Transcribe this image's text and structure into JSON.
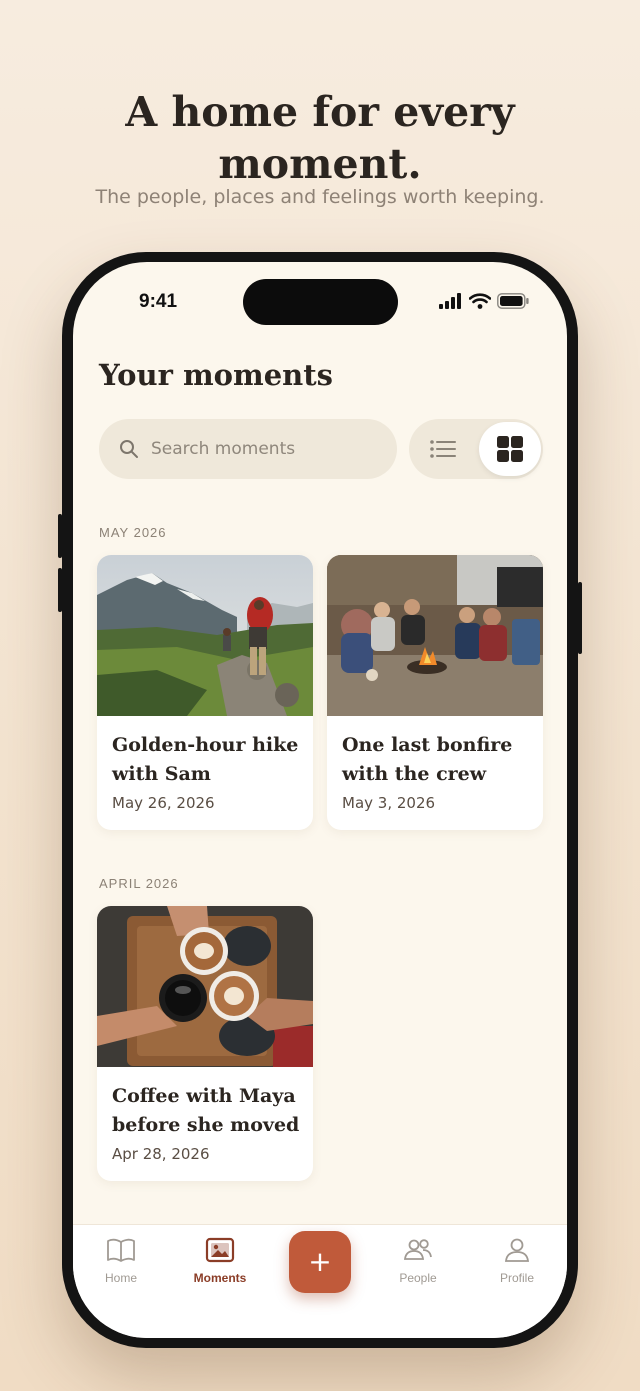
{
  "hero": {
    "title_line1": "A home for every",
    "title_line2": "moment.",
    "subtitle": "The people, places and feelings worth keeping."
  },
  "status": {
    "time": "9:41"
  },
  "page": {
    "title": "Your moments"
  },
  "search": {
    "placeholder": "Search moments",
    "icon": "search-icon"
  },
  "view_toggle": {
    "options": [
      "list",
      "grid"
    ],
    "selected": "grid"
  },
  "sections": [
    {
      "label": "MAY 2026",
      "cards": [
        {
          "title": "Golden-hour hike with Sam",
          "date": "May 26, 2026",
          "image": "mountain-hike-photo"
        },
        {
          "title": "One last bonfire with the crew",
          "date": "May 3, 2026",
          "image": "bonfire-friends-photo"
        }
      ]
    },
    {
      "label": "APRIL 2026",
      "cards": [
        {
          "title": "Coffee with Maya before she moved",
          "date": "Apr 28, 2026",
          "image": "coffee-cheers-photo"
        }
      ]
    }
  ],
  "tabbar": {
    "items": [
      {
        "label": "Home",
        "icon": "book-icon"
      },
      {
        "label": "Moments",
        "icon": "photo-album-icon",
        "active": true
      },
      {
        "label": "People",
        "icon": "people-icon"
      },
      {
        "label": "Profile",
        "icon": "person-icon"
      }
    ],
    "fab_label": "+"
  },
  "colors": {
    "accent": "#c05a3a",
    "active_tab": "#8b3d27",
    "background": "#fcf7ed"
  }
}
